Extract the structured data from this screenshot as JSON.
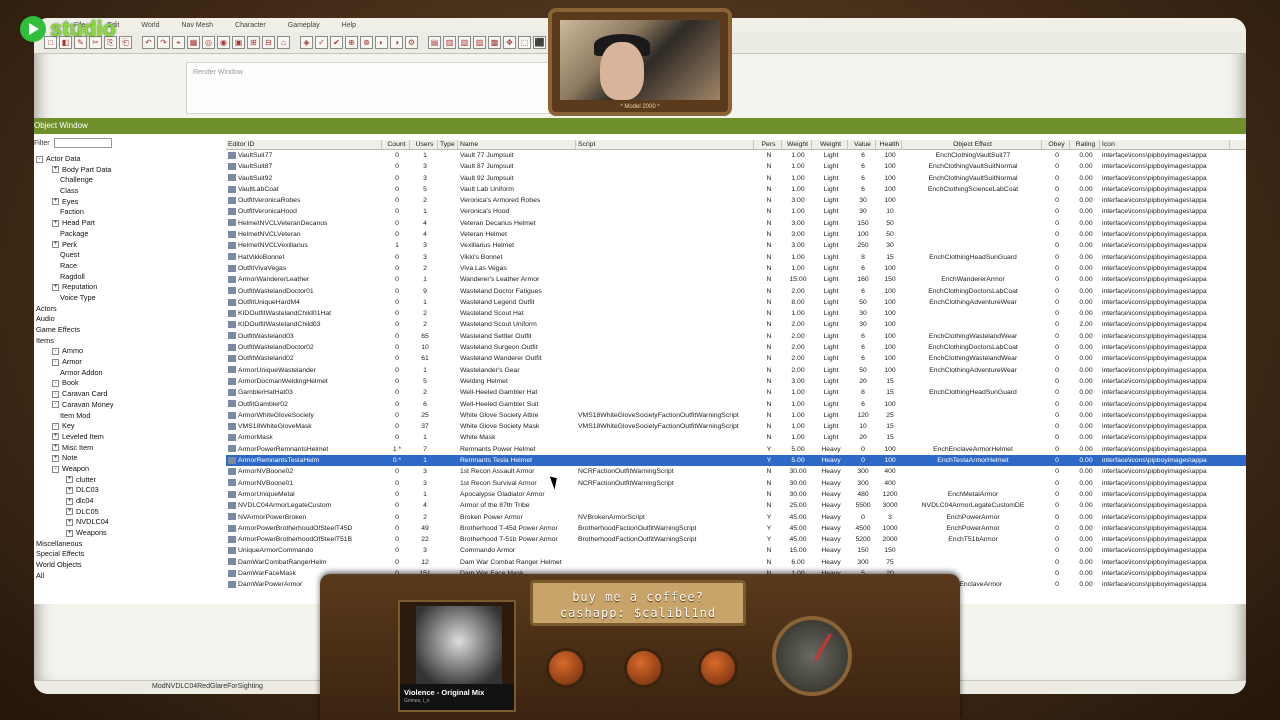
{
  "menu": [
    "File",
    "Edit",
    "World",
    "Nav Mesh",
    "Character",
    "Gameplay",
    "Help"
  ],
  "render_window": {
    "title": "Render Window"
  },
  "object_window": {
    "title": "Object Window",
    "filter_label": "Filter"
  },
  "tree": [
    {
      "label": "Actor Data",
      "level": 0,
      "box": "-"
    },
    {
      "label": "Body Part Data",
      "level": 1,
      "box": "+"
    },
    {
      "label": "Challenge",
      "level": 2
    },
    {
      "label": "Class",
      "level": 2
    },
    {
      "label": "Eyes",
      "level": 1,
      "box": "+"
    },
    {
      "label": "Faction",
      "level": 2
    },
    {
      "label": "Head Part",
      "level": 1,
      "box": "+"
    },
    {
      "label": "Package",
      "level": 2
    },
    {
      "label": "Perk",
      "level": 1,
      "box": "+"
    },
    {
      "label": "Quest",
      "level": 2
    },
    {
      "label": "Race",
      "level": 2
    },
    {
      "label": "Ragdoll",
      "level": 2
    },
    {
      "label": "Reputation",
      "level": 1,
      "box": "+"
    },
    {
      "label": "Voice Type",
      "level": 2
    },
    {
      "label": "Actors",
      "level": 0
    },
    {
      "label": "Audio",
      "level": 0
    },
    {
      "label": "Game Effects",
      "level": 0
    },
    {
      "label": "Items",
      "level": 0
    },
    {
      "label": "Ammo",
      "level": 1,
      "box": "-"
    },
    {
      "label": "Armor",
      "level": 1,
      "box": "-"
    },
    {
      "label": "Armor Addon",
      "level": 2
    },
    {
      "label": "Book",
      "level": 1,
      "box": "-"
    },
    {
      "label": "Caravan Card",
      "level": 1,
      "box": "-"
    },
    {
      "label": "Caravan Money",
      "level": 1,
      "box": "-"
    },
    {
      "label": "Item Mod",
      "level": 2
    },
    {
      "label": "Key",
      "level": 1,
      "box": "-"
    },
    {
      "label": "Leveled Item",
      "level": 1,
      "box": "+"
    },
    {
      "label": "Misc Item",
      "level": 1,
      "box": "+"
    },
    {
      "label": "Note",
      "level": 1,
      "box": "+"
    },
    {
      "label": "Weapon",
      "level": 1,
      "box": "-"
    },
    {
      "label": "clutter",
      "level": 3,
      "box": "+"
    },
    {
      "label": "DLC03",
      "level": 3,
      "box": "+"
    },
    {
      "label": "dlc04",
      "level": 3,
      "box": "+"
    },
    {
      "label": "DLC05",
      "level": 3,
      "box": "+"
    },
    {
      "label": "NVDLC04",
      "level": 3,
      "box": "+"
    },
    {
      "label": "Weapons",
      "level": 3,
      "box": "+"
    },
    {
      "label": "Miscellaneous",
      "level": 0
    },
    {
      "label": "Special Effects",
      "level": 0
    },
    {
      "label": "World Objects",
      "level": 0
    },
    {
      "label": "All",
      "level": 0
    }
  ],
  "columns": [
    "Editor ID",
    "Count",
    "Users",
    "Type",
    "Name",
    "Script",
    "Pers",
    "Weight",
    "Weight",
    "Value",
    "Health",
    "Object Effect",
    "Obey",
    "Rating",
    "Icon"
  ],
  "rows": [
    [
      "VaultSuit77",
      "0",
      "1",
      "",
      "Vault 77 Jumpsuit",
      "",
      "N",
      "1.00",
      "Light",
      "6",
      "100",
      "EnchClothingVaultSuit77",
      "0",
      "0.00",
      "interface\\icons\\pipboyimages\\appa"
    ],
    [
      "VaultSuit87",
      "0",
      "3",
      "",
      "Vault 87 Jumpsuit",
      "",
      "N",
      "1.00",
      "Light",
      "6",
      "100",
      "EnchClothingVaultSuitNormal",
      "0",
      "0.00",
      "interface\\icons\\pipboyimages\\appa"
    ],
    [
      "VaultSuit92",
      "0",
      "3",
      "",
      "Vault 92 Jumpsuit",
      "",
      "N",
      "1.00",
      "Light",
      "6",
      "100",
      "EnchClothingVaultSuitNormal",
      "0",
      "0.00",
      "interface\\icons\\pipboyimages\\appa"
    ],
    [
      "VaultLabCoat",
      "0",
      "5",
      "",
      "Vault Lab Uniform",
      "",
      "N",
      "1.00",
      "Light",
      "6",
      "100",
      "EnchClothingScienceLabCoat",
      "0",
      "0.00",
      "interface\\icons\\pipboyimages\\appa"
    ],
    [
      "OutfitVeronicaRobes",
      "0",
      "2",
      "",
      "Veronica's Armored Robes",
      "",
      "N",
      "3.00",
      "Light",
      "30",
      "100",
      "",
      "0",
      "0.00",
      "interface\\icons\\pipboyimages\\appa"
    ],
    [
      "OutfitVeronicaHood",
      "0",
      "1",
      "",
      "Veronica's Hood",
      "",
      "N",
      "1.00",
      "Light",
      "30",
      "10",
      "",
      "0",
      "0.00",
      "interface\\icons\\pipboyimages\\appa"
    ],
    [
      "HelmetNVCLVeteranDecanus",
      "0",
      "4",
      "",
      "Veteran Decanus Helmet",
      "",
      "N",
      "3.00",
      "Light",
      "150",
      "50",
      "",
      "0",
      "0.00",
      "interface\\icons\\pipboyimages\\appa"
    ],
    [
      "HelmetNVCLVeteran",
      "0",
      "4",
      "",
      "Veteran Helmet",
      "",
      "N",
      "3.00",
      "Light",
      "100",
      "50",
      "",
      "0",
      "0.00",
      "interface\\icons\\pipboyimages\\appa"
    ],
    [
      "HelmetNVCLVexillarius",
      "1",
      "3",
      "",
      "Vexillarius Helmet",
      "",
      "N",
      "3.00",
      "Light",
      "250",
      "30",
      "",
      "0",
      "0.00",
      "interface\\icons\\pipboyimages\\appa"
    ],
    [
      "HatVikkiBonnet",
      "0",
      "3",
      "",
      "Vikki's Bonnet",
      "",
      "N",
      "1.00",
      "Light",
      "8",
      "15",
      "EnchClothingHeadSunGuard",
      "0",
      "0.00",
      "interface\\icons\\pipboyimages\\appa"
    ],
    [
      "OutfitVivaVegas",
      "0",
      "2",
      "",
      "Viva Las Vegas",
      "",
      "N",
      "1.00",
      "Light",
      "6",
      "100",
      "",
      "0",
      "0.00",
      "interface\\icons\\pipboyimages\\appa"
    ],
    [
      "ArmorWandererLeather",
      "0",
      "1",
      "",
      "Wanderer's Leather Armor",
      "",
      "N",
      "15.00",
      "Light",
      "160",
      "150",
      "EnchWandererArmor",
      "0",
      "0.00",
      "interface\\icons\\pipboyimages\\appa"
    ],
    [
      "OutfitWastelandDoctor01",
      "0",
      "9",
      "",
      "Wasteland Doctor Fatigues",
      "",
      "N",
      "2.00",
      "Light",
      "6",
      "100",
      "EnchClothingDoctorsLabCoat",
      "0",
      "0.00",
      "interface\\icons\\pipboyimages\\appa"
    ],
    [
      "OutfitUniqueHardM4",
      "0",
      "1",
      "",
      "Wasteland Legend Outfit",
      "",
      "N",
      "8.00",
      "Light",
      "50",
      "100",
      "EnchClothingAdventureWear",
      "0",
      "0.00",
      "interface\\icons\\pipboyimages\\appa"
    ],
    [
      "KIDOutfitWastelandChild01Hat",
      "0",
      "2",
      "",
      "Wasteland Scout Hat",
      "",
      "N",
      "1.00",
      "Light",
      "30",
      "100",
      "",
      "0",
      "0.00",
      "interface\\icons\\pipboyimages\\appa"
    ],
    [
      "KIDOutfitWastelandChild03",
      "0",
      "2",
      "",
      "Wasteland Scout Uniform",
      "",
      "N",
      "2.00",
      "Light",
      "30",
      "100",
      "",
      "0",
      "2.00",
      "interface\\icons\\pipboyimages\\appa"
    ],
    [
      "OutfitWasteland03",
      "0",
      "65",
      "",
      "Wasteland Settler Outfit",
      "",
      "N",
      "2.00",
      "Light",
      "6",
      "100",
      "EnchClothingWastelandWear",
      "0",
      "0.00",
      "interface\\icons\\pipboyimages\\appa"
    ],
    [
      "OutfitWastelandDoctor02",
      "0",
      "10",
      "",
      "Wasteland Surgeon Outfit",
      "",
      "N",
      "2.00",
      "Light",
      "6",
      "100",
      "EnchClothingDoctorsLabCoat",
      "0",
      "0.00",
      "interface\\icons\\pipboyimages\\appa"
    ],
    [
      "OutfitWasteland02",
      "0",
      "61",
      "",
      "Wasteland Wanderer Outfit",
      "",
      "N",
      "2.00",
      "Light",
      "6",
      "100",
      "EnchClothingWastelandWear",
      "0",
      "0.00",
      "interface\\icons\\pipboyimages\\appa"
    ],
    [
      "ArmorUniqueWastelander",
      "0",
      "1",
      "",
      "Wastelander's Gear",
      "",
      "N",
      "2.00",
      "Light",
      "50",
      "100",
      "EnchClothingAdventureWear",
      "0",
      "0.00",
      "interface\\icons\\pipboyimages\\appa"
    ],
    [
      "ArmorDocmanWeldingHelmet",
      "0",
      "5",
      "",
      "Welding Helmet",
      "",
      "N",
      "3.00",
      "Light",
      "20",
      "15",
      "",
      "0",
      "0.00",
      "interface\\icons\\pipboyimages\\appa"
    ],
    [
      "GamblerHatHat03",
      "0",
      "2",
      "",
      "Well-Heeled Gambler Hat",
      "",
      "N",
      "1.00",
      "Light",
      "8",
      "15",
      "EnchClothingHeadSunGuard",
      "0",
      "0.00",
      "interface\\icons\\pipboyimages\\appa"
    ],
    [
      "OutfitGambler02",
      "0",
      "6",
      "",
      "Well-Heeled Gambler Suit",
      "",
      "N",
      "1.00",
      "Light",
      "6",
      "100",
      "",
      "0",
      "0.00",
      "interface\\icons\\pipboyimages\\appa"
    ],
    [
      "ArmorWhiteGloveSociety",
      "0",
      "25",
      "",
      "White Glove Society Attire",
      "VMS18WhiteGloveSocietyFactionOutfitWarningScript",
      "N",
      "1.00",
      "Light",
      "120",
      "25",
      "",
      "0",
      "0.00",
      "interface\\icons\\pipboyimages\\appa"
    ],
    [
      "VMS18WhiteGloveMask",
      "0",
      "37",
      "",
      "White Glove Society Mask",
      "VMS18WhiteGloveSocietyFactionOutfitWarningScript",
      "N",
      "1.00",
      "Light",
      "10",
      "15",
      "",
      "0",
      "0.00",
      "interface\\icons\\pipboyimages\\appa"
    ],
    [
      "ArmorMask",
      "0",
      "1",
      "",
      "White Mask",
      "",
      "N",
      "1.00",
      "Light",
      "20",
      "15",
      "",
      "0",
      "0.00",
      "interface\\icons\\pipboyimages\\appa"
    ],
    [
      "ArmorPowerRemnantsHelmet",
      "1 *",
      "7",
      "",
      "Remnants Power Helmet",
      "",
      "Y",
      "5.00",
      "Heavy",
      "0",
      "100",
      "EnchEnclaveArmorHelmet",
      "0",
      "0.00",
      "interface\\icons\\pipboyimages\\appa"
    ],
    [
      "ArmorRemnantsTeslaHelm",
      "0 *",
      "1",
      "",
      "Remnants Tesla Helmet",
      "",
      "Y",
      "5.00",
      "Heavy",
      "0",
      "100",
      "EnchTeslaArmorHelmet",
      "0",
      "0.00",
      "interface\\icons\\pipboyimages\\appa"
    ],
    [
      "ArmorNVBoone02",
      "0",
      "3",
      "",
      "1st Recon Assault Armor",
      "NCRFactionOutfitWarningScript",
      "N",
      "30.00",
      "Heavy",
      "300",
      "400",
      "",
      "0",
      "0.00",
      "interface\\icons\\pipboyimages\\appa"
    ],
    [
      "ArmorNVBoone01",
      "0",
      "3",
      "",
      "1st Recon Survival Armor",
      "NCRFactionOutfitWarningScript",
      "N",
      "30.00",
      "Heavy",
      "300",
      "400",
      "",
      "0",
      "0.00",
      "interface\\icons\\pipboyimages\\appa"
    ],
    [
      "ArmorUniqueMetal",
      "0",
      "1",
      "",
      "Apocalypse Gladiator Armor",
      "",
      "N",
      "30.00",
      "Heavy",
      "480",
      "1200",
      "EnchMetalArmor",
      "0",
      "0.00",
      "interface\\icons\\pipboyimages\\appa"
    ],
    [
      "NVDLC04ArmorLegateCustom",
      "0",
      "4",
      "",
      "Armor of the 87th Tribe",
      "",
      "N",
      "25.00",
      "Heavy",
      "5500",
      "3000",
      "NVDLC04ArmorLegateCustomDE",
      "0",
      "0.00",
      "interface\\icons\\pipboyimages\\appa"
    ],
    [
      "NVArmorPowerBroken",
      "0",
      "2",
      "",
      "Broken Power Armor",
      "NVBrokenArmorScript",
      "Y",
      "45.00",
      "Heavy",
      "0",
      "3",
      "EnchPowerArmor",
      "0",
      "0.00",
      "interface\\icons\\pipboyimages\\appa"
    ],
    [
      "ArmorPowerBrotherhoodOfSteelT45D",
      "0",
      "49",
      "",
      "Brotherhood T-45d Power Armor",
      "BrotherhoodFactionOutfitWarningScript",
      "Y",
      "45.00",
      "Heavy",
      "4500",
      "1000",
      "EnchPowerArmor",
      "0",
      "0.00",
      "interface\\icons\\pipboyimages\\appa"
    ],
    [
      "ArmorPowerBrotherhoodOfSteelT51B",
      "0",
      "22",
      "",
      "Brotherhood T-51b Power Armor",
      "BrotherhoodFactionOutfitWarningScript",
      "Y",
      "45.00",
      "Heavy",
      "5200",
      "2000",
      "EnchT51bArmor",
      "0",
      "0.00",
      "interface\\icons\\pipboyimages\\appa"
    ],
    [
      "UniqueArmorCommando",
      "0",
      "3",
      "",
      "Commando Armor",
      "",
      "N",
      "15.00",
      "Heavy",
      "150",
      "150",
      "",
      "0",
      "0.00",
      "interface\\icons\\pipboyimages\\appa"
    ],
    [
      "DamWarCombatRangerHelm",
      "0",
      "12",
      "",
      "Dam War Combat Ranger Helmet",
      "",
      "N",
      "6.00",
      "Heavy",
      "300",
      "75",
      "",
      "0",
      "0.00",
      "interface\\icons\\pipboyimages\\appa"
    ],
    [
      "DamWarFaceMask",
      "0",
      "151",
      "",
      "Dam War Face Mask",
      "",
      "N",
      "1.00",
      "Heavy",
      "5",
      "20",
      "",
      "0",
      "0.00",
      "interface\\icons\\pipboyimages\\appa"
    ],
    [
      "DamWarPowerArmor",
      "0",
      "7",
      "",
      "Dam War power armor",
      "",
      "Y",
      "45.00",
      "Heavy",
      "740",
      "1200",
      "EnchEnclaveArmor",
      "0",
      "0.00",
      "interface\\icons\\pipboyimages\\appa"
    ]
  ],
  "selected_row": 27,
  "status_text": "ModNVDLC04RedGlareForSighting",
  "overlay": {
    "logo_text": "studio",
    "webcam_caption": "* Model 2000 *",
    "coffee_line1": "buy me a coffee?",
    "coffee_line2": "cashapp: $calibl1nd",
    "track_title": "Violence - Original Mix",
    "track_artist": "Grimes, i_o"
  },
  "colors": {
    "accent_green": "#6e8f2a",
    "selection_blue": "#2e69c7"
  }
}
